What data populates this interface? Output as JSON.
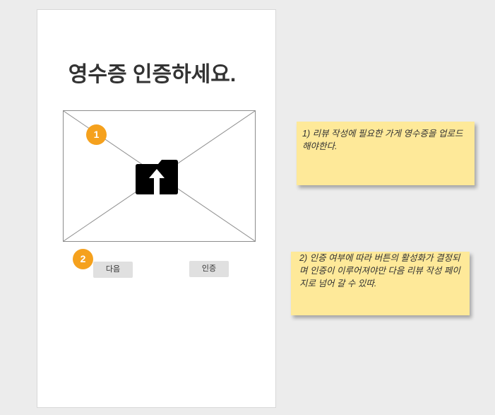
{
  "screen": {
    "title": "영수증 인증하세요.",
    "upload_icon": "folder-upload-icon",
    "badges": [
      {
        "label": "1"
      },
      {
        "label": "2"
      }
    ],
    "buttons": {
      "next_label": "다음",
      "verify_label": "인증"
    }
  },
  "annotations": [
    {
      "text": "1) 리뷰 작성에 필요한 가게 영수증을 업로드 해야한다."
    },
    {
      "text": "2) 인증 여부에 따라 버튼의 활성화가 결정되며 인증이 이루어져야만 다음 리뷰 작성 페이지로 넘어 갈 수 있따."
    }
  ],
  "colors": {
    "background": "#ececec",
    "accent": "#f5a11d",
    "note": "#fee999"
  }
}
